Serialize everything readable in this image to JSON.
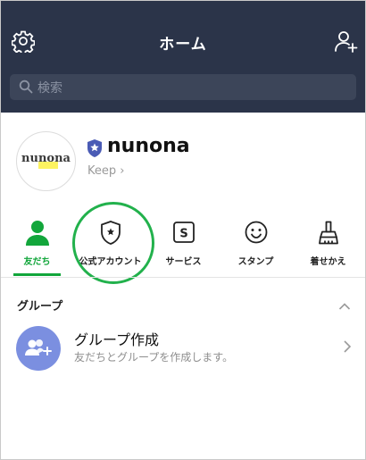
{
  "header": {
    "title": "ホーム",
    "search_placeholder": "検索",
    "bg_color": "#2b3449"
  },
  "profile": {
    "avatar_text": "nunona",
    "name": "nunona",
    "keep_label": "Keep ›"
  },
  "tabs": [
    {
      "label": "友だち",
      "icon": "person-icon",
      "active": true
    },
    {
      "label": "公式アカウント",
      "icon": "shield-star-icon",
      "active": false
    },
    {
      "label": "サービス",
      "icon": "s-box-icon",
      "active": false
    },
    {
      "label": "スタンプ",
      "icon": "smiley-icon",
      "active": false
    },
    {
      "label": "着せかえ",
      "icon": "brush-icon",
      "active": false
    }
  ],
  "accent_color": "#12a63b",
  "group_section": {
    "heading": "グループ",
    "create_title": "グループ作成",
    "create_subtitle": "友だちとグループを作成します。"
  }
}
